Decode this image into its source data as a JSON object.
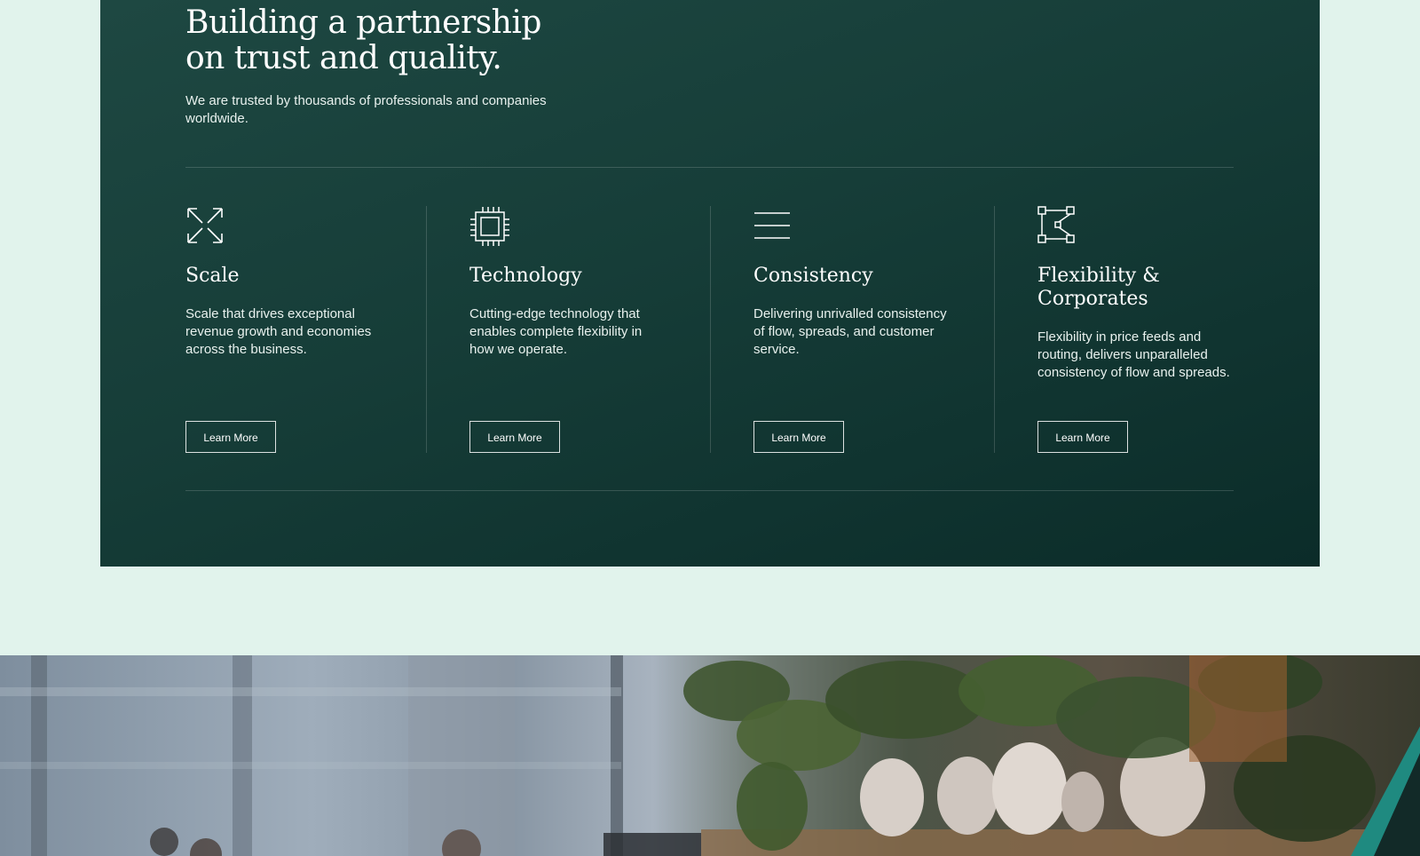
{
  "section": {
    "heading_line1": "Building a partnership",
    "heading_line2": "on trust and quality.",
    "subtext": "We are trusted by thousands of professionals and companies worldwide."
  },
  "features": [
    {
      "icon": "expand-arrows-icon",
      "title": "Scale",
      "description": "Scale that drives exceptional revenue growth and economies across the business.",
      "button_label": "Learn More"
    },
    {
      "icon": "chip-icon",
      "title": "Technology",
      "description": "Cutting-edge technology that enables complete flexibility in how we operate.",
      "button_label": "Learn More"
    },
    {
      "icon": "lines-icon",
      "title": "Consistency",
      "description": "Delivering unrivalled consistency of flow, spreads, and customer service.",
      "button_label": "Learn More"
    },
    {
      "icon": "vector-path-icon",
      "title": "Flexibility & Corporates",
      "description": "Flexibility in price feeds and routing, delivers unparalleled consistency of flow and spreads.",
      "button_label": "Learn More"
    }
  ],
  "colors": {
    "page_background": "#e1f3ec",
    "panel_dark_green": "#163d38",
    "accent_teal": "#1f8a80",
    "text_white": "#ffffff"
  }
}
